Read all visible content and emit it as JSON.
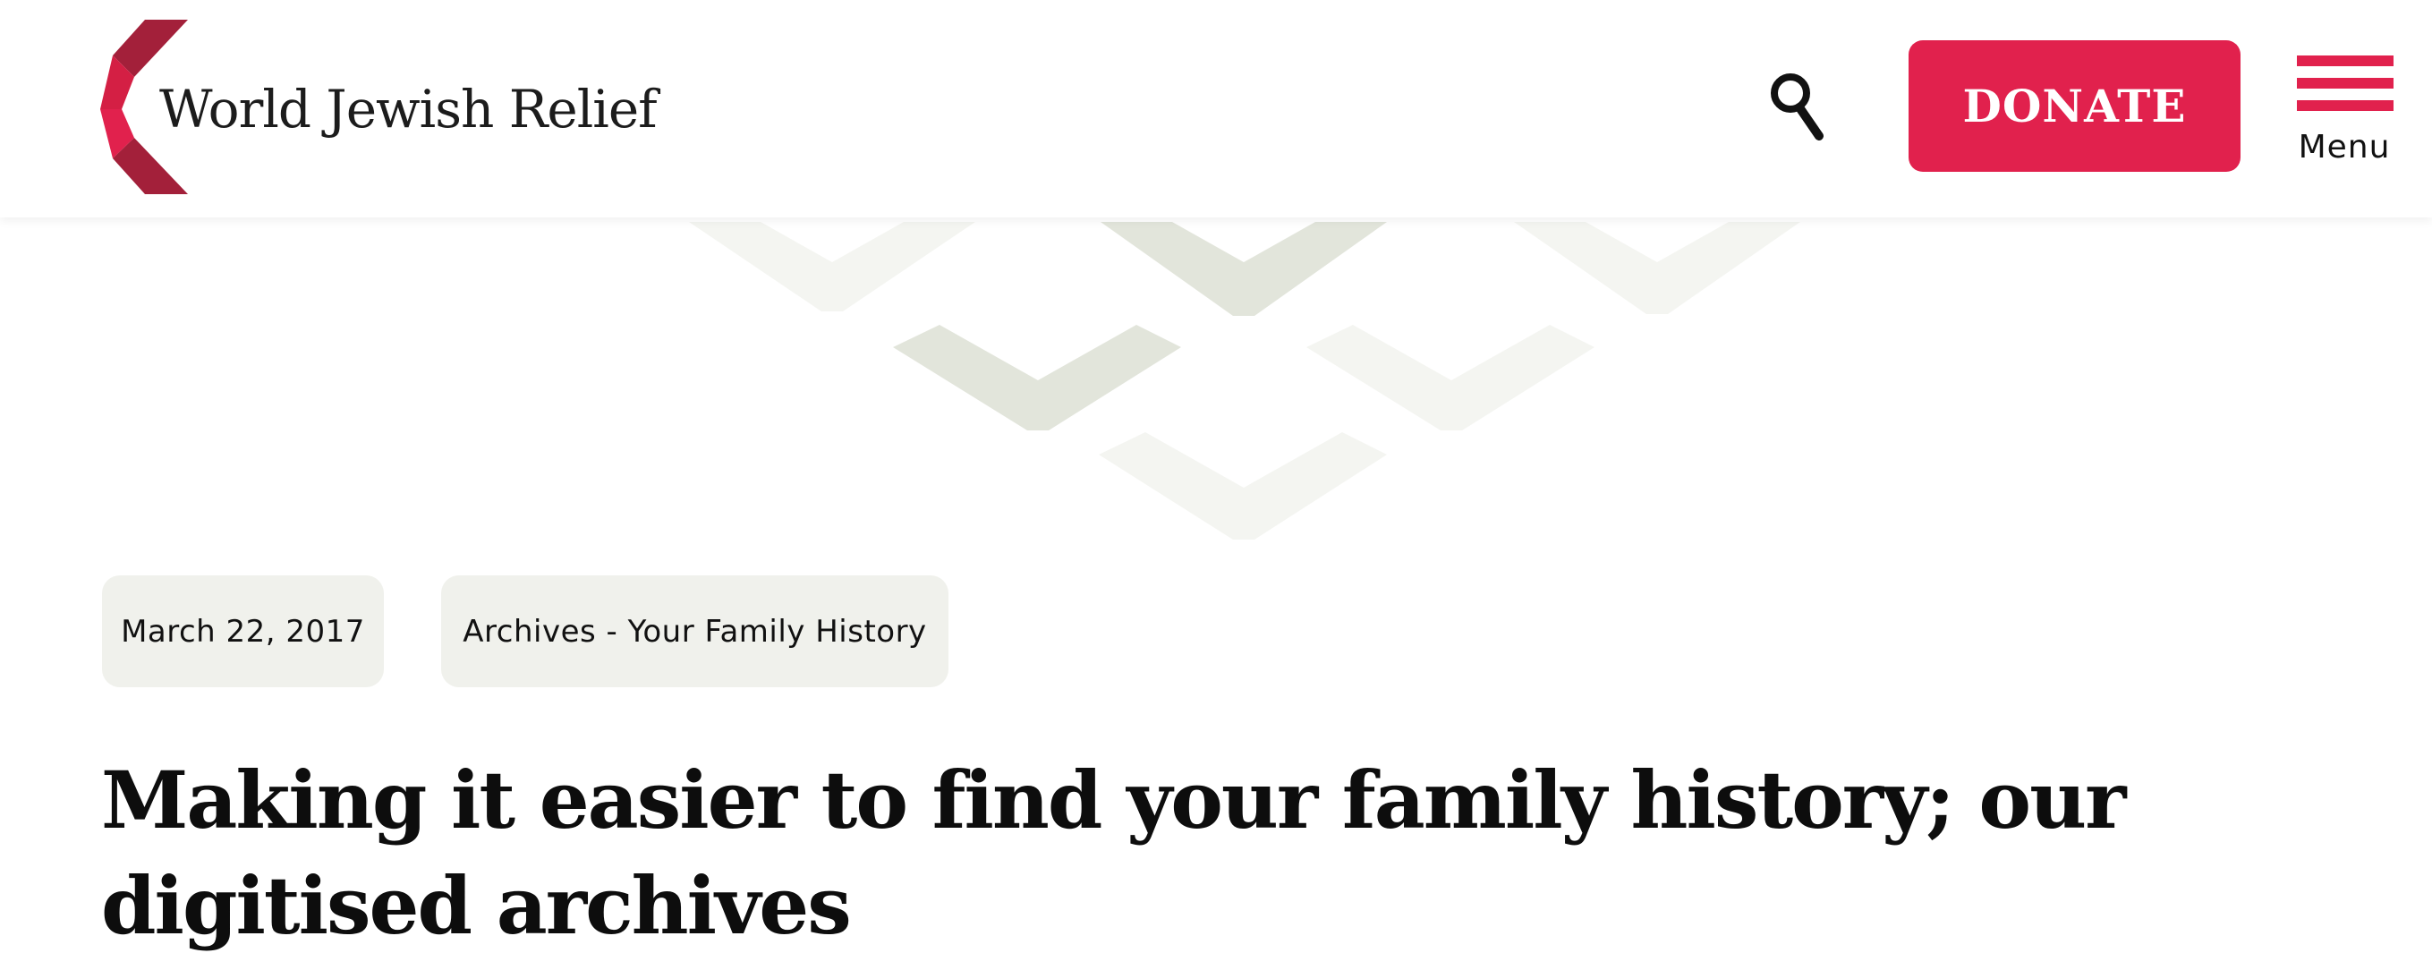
{
  "header": {
    "logo_text": "World Jewish Relief",
    "logo_icon": "wjr-chevron-logo-icon",
    "search_icon": "search-icon",
    "donate_label": "DONATE",
    "menu_icon": "hamburger-menu-icon",
    "menu_label": "Menu"
  },
  "post": {
    "date": "March 22, 2017",
    "category": "Archives - Your Family History",
    "title": "Making it easier to find your family history; our digitised archives"
  },
  "colors": {
    "brand_red": "#e1214d",
    "brand_dark_red": "#a3203a",
    "tag_background": "#f0f1ec",
    "pattern_green": "#e0e3d8",
    "pattern_light": "#f3f4f0"
  }
}
